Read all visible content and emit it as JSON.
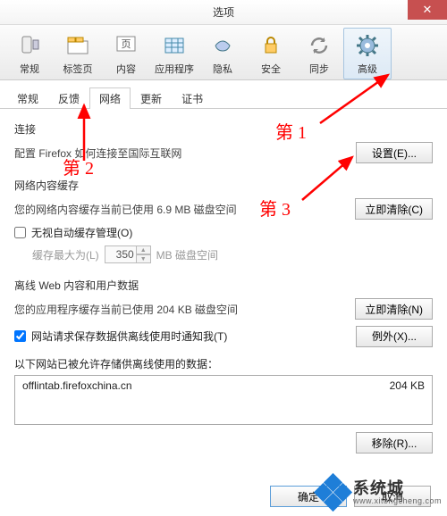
{
  "window": {
    "title": "选项"
  },
  "toolbar": {
    "items": [
      {
        "label": "常规"
      },
      {
        "label": "标签页"
      },
      {
        "label": "内容"
      },
      {
        "label": "应用程序"
      },
      {
        "label": "隐私"
      },
      {
        "label": "安全"
      },
      {
        "label": "同步"
      },
      {
        "label": "高级"
      }
    ]
  },
  "subtabs": {
    "items": [
      {
        "label": "常规"
      },
      {
        "label": "反馈"
      },
      {
        "label": "网络"
      },
      {
        "label": "更新"
      },
      {
        "label": "证书"
      }
    ]
  },
  "connection": {
    "title": "连接",
    "desc": "配置 Firefox 如何连接至国际互联网",
    "settings_btn": "设置(E)..."
  },
  "cache": {
    "title": "网络内容缓存",
    "desc": "您的网络内容缓存当前已使用 6.9 MB 磁盘空间",
    "clear_btn": "立即清除(C)",
    "override_label": "无视自动缓存管理(O)",
    "limit_prefix": "缓存最大为(L)",
    "limit_value": "350",
    "limit_suffix": "MB 磁盘空间"
  },
  "offline": {
    "title": "离线 Web 内容和用户数据",
    "desc": "您的应用程序缓存当前已使用 204 KB 磁盘空间",
    "clear_btn": "立即清除(N)",
    "notify_label": "网站请求保存数据供离线使用时通知我(T)",
    "except_btn": "例外(X)...",
    "list_label": "以下网站已被允许存储供离线使用的数据：",
    "rows": [
      {
        "name": "offlintab.firefoxchina.cn",
        "size": "204 KB"
      }
    ],
    "remove_btn": "移除(R)..."
  },
  "footer": {
    "ok": "确定",
    "cancel": "取消"
  },
  "annotations": {
    "a1": "第 1",
    "a2": "第 2",
    "a3": "第 3"
  },
  "watermark": {
    "brand": "系统城",
    "url": "www.xitongcheng.com"
  }
}
